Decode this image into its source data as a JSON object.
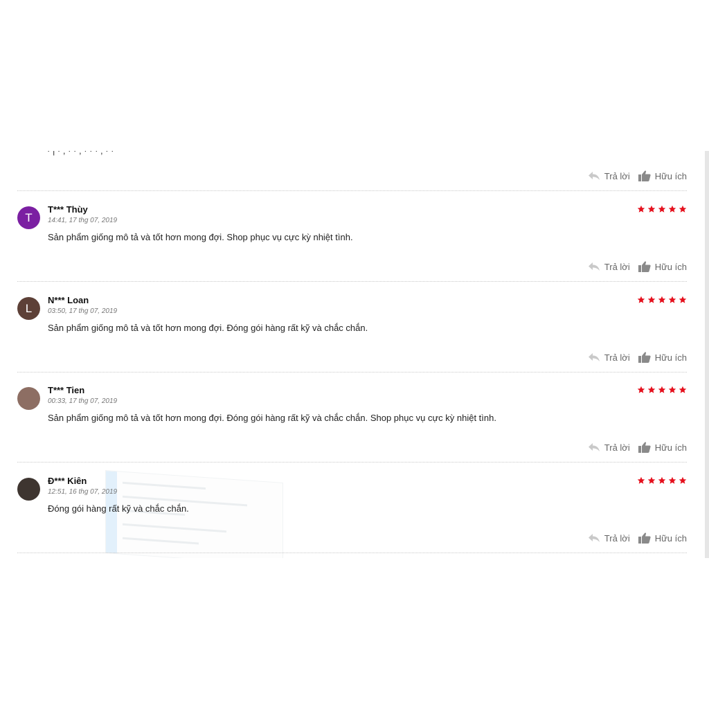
{
  "actions": {
    "reply_label": "Trả lời",
    "helpful_label": "Hữu ích"
  },
  "top_cut_text": "· | · , · · , · · · , · ·",
  "star_color": "#e5101d",
  "reviews": [
    {
      "name": "T*** Thùy",
      "date": "14:41, 17 thg 07, 2019",
      "text": "Sản phẩm giống mô tả và tốt hơn mong đợi. Shop phục vụ cực kỳ nhiệt tình.",
      "initial": "T",
      "avatar_color": "#7b1fa2",
      "rating": 5
    },
    {
      "name": "N*** Loan",
      "date": "03:50, 17 thg 07, 2019",
      "text": "Sản phẩm giống mô tả và tốt hơn mong đợi. Đóng gói hàng rất kỹ và chắc chắn.",
      "initial": "L",
      "avatar_color": "#5d4037",
      "rating": 5
    },
    {
      "name": "T*** Tien",
      "date": "00:33, 17 thg 07, 2019",
      "text": "Sản phẩm giống mô tả và tốt hơn mong đợi. Đóng gói hàng rất kỹ và chắc chắn. Shop phục vụ cực kỳ nhiệt tình.",
      "initial": "",
      "avatar_color": "#8d6e63",
      "rating": 5
    },
    {
      "name": "Đ*** Kiên",
      "date": "12:51, 16 thg 07, 2019",
      "text": "Đóng gói hàng rất kỹ và chắc chắn.",
      "initial": "",
      "avatar_color": "#3e3530",
      "rating": 5
    }
  ]
}
